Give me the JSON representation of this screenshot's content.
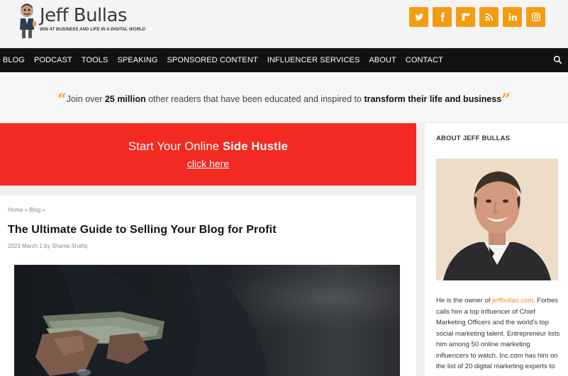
{
  "header": {
    "logo_title": "Jeff Bullas",
    "logo_tagline": "WIN AT BUSINESS AND LIFE IN A DIGITAL WORLD",
    "social_icons": [
      "twitter-icon",
      "facebook-icon",
      "flipboard-icon",
      "rss-icon",
      "linkedin-icon",
      "instagram-icon"
    ],
    "accent_color": "#f39c12"
  },
  "nav": {
    "items": [
      "BLOG",
      "PODCAST",
      "TOOLS",
      "SPEAKING",
      "SPONSORED CONTENT",
      "INFLUENCER SERVICES",
      "ABOUT",
      "CONTACT"
    ],
    "search_icon": "search-icon"
  },
  "join": {
    "part1": "Join over ",
    "count": "25 million",
    "part2": " other readers that have been educated and inspired to ",
    "emphasis": "transform their life and business"
  },
  "promo": {
    "line_prefix": "Start Your Online ",
    "line_bold": "Side Hustle",
    "link": "click here",
    "color": "#f22a22"
  },
  "article": {
    "breadcrumb_home": "Home",
    "breadcrumb_sep": " » ",
    "breadcrumb_blog": "Blog",
    "breadcrumb_trail": " »",
    "title": "The Ultimate Guide to Selling Your Blog for Profit",
    "date": "2023 March 1",
    "by": " by ",
    "author": "Shama Shafiq"
  },
  "sidebar": {
    "title": "ABOUT JEFF BULLAS",
    "bio_prefix": "He is the owner of ",
    "bio_link": "jeffbullas.com",
    "bio_rest": ". Forbes calls him a top influencer of Chief Marketing Officers and the world's top social marketing talent. Entrepreneur lists him among 50 online marketing influencers to watch. Inc.com has him on the list of 20 digital marketing experts to"
  }
}
